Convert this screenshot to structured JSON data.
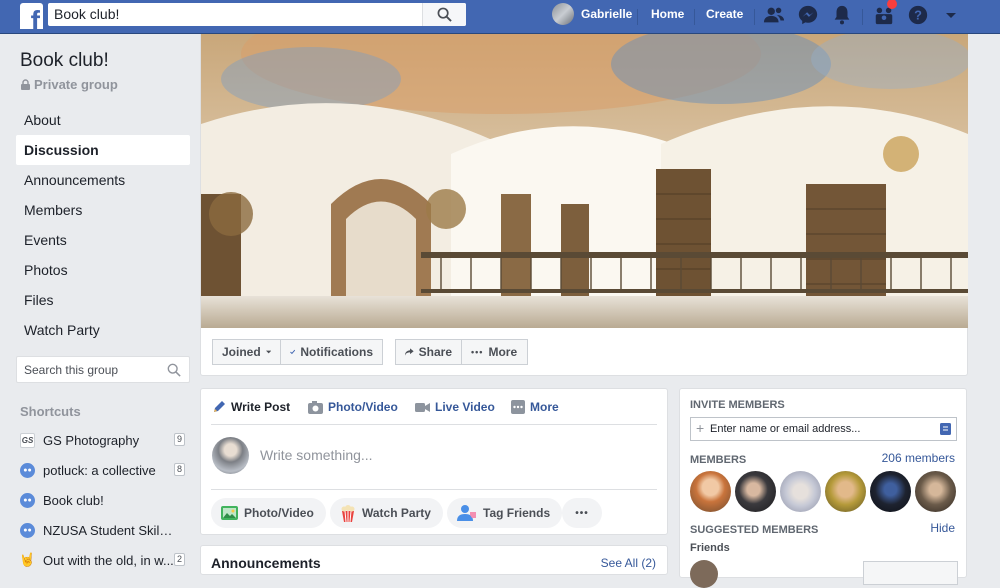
{
  "topbar": {
    "logo_letter": "f",
    "search_value": "Book club!",
    "user_name": "Gabrielle",
    "home": "Home",
    "create": "Create",
    "icons": [
      "friend-requests-icon",
      "messenger-icon",
      "notifications-icon",
      "groups-icon",
      "help-icon",
      "account-menu-icon"
    ]
  },
  "group": {
    "title": "Book club!",
    "privacy": "Private group"
  },
  "menu": {
    "items": [
      "About",
      "Discussion",
      "Announcements",
      "Members",
      "Events",
      "Photos",
      "Files",
      "Watch Party"
    ],
    "active": "Discussion"
  },
  "group_search": {
    "placeholder": "Search this group"
  },
  "shortcuts": {
    "heading": "Shortcuts",
    "items": [
      {
        "icon_text": "GS",
        "label": "GS Photography",
        "count": "9"
      },
      {
        "label": "potluck: a collective",
        "count": "8"
      },
      {
        "label": "Book club!"
      },
      {
        "label": "NZUSA Student Skill S..."
      },
      {
        "icon_text": "🤘",
        "label": "Out with the old, in w...",
        "count": "2"
      }
    ]
  },
  "actions": {
    "joined": "Joined",
    "notifications": "Notifications",
    "share": "Share",
    "more": "More"
  },
  "composer": {
    "tabs": [
      "Write Post",
      "Photo/Video",
      "Live Video",
      "More"
    ],
    "placeholder": "Write something...",
    "pills": [
      "Photo/Video",
      "Watch Party",
      "Tag Friends"
    ],
    "more_dots": "•••"
  },
  "announcements": {
    "title": "Announcements",
    "see_all": "See All (2)"
  },
  "sidebar": {
    "invite_heading": "INVITE MEMBERS",
    "invite_placeholder": "Enter name or email address...",
    "members_heading": "MEMBERS",
    "members_count": "206 members",
    "suggested_heading": "SUGGESTED MEMBERS",
    "hide": "Hide",
    "friends_label": "Friends",
    "member_avatar_colors": [
      "#c9743c",
      "#3b3a3e",
      "#c6c9d6",
      "#b59a3a",
      "#1e2330",
      "#6b5b4a"
    ]
  },
  "colors": {
    "brand": "#4267b2",
    "link": "#365899",
    "background": "#e9ebee"
  }
}
